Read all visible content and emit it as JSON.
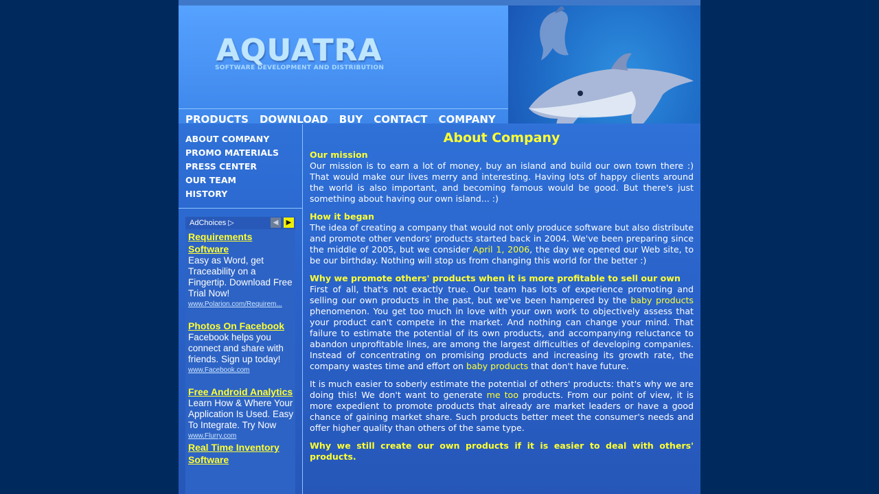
{
  "brand": {
    "logo": "AQUATRA",
    "tagline": "SOFTWARE DEVELOPMENT AND DISTRIBUTION"
  },
  "topnav": [
    "PRODUCTS",
    "DOWNLOAD",
    "BUY",
    "CONTACT",
    "COMPANY"
  ],
  "sidenav": [
    "ABOUT COMPANY",
    "PROMO MATERIALS",
    "PRESS CENTER",
    "OUR TEAM",
    "HISTORY"
  ],
  "ads": {
    "adchoices": "AdChoices",
    "items": [
      {
        "title": "Requirements Software",
        "text": "Easy as Word, get Traceability on a Fingertip. Download Free Trial Now!",
        "url": "www.Polarion.com/Requirem..."
      },
      {
        "title": "Photos On Facebook",
        "text": "Facebook helps you connect and share with friends. Sign up today!",
        "url": "www.Facebook.com"
      },
      {
        "title": "Free Android Analytics",
        "text": "Learn How & Where Your Application Is Used. Easy To Integrate. Try Now",
        "url": "www.Flurry.com"
      },
      {
        "title": "Real Time Inventory Software",
        "text": "",
        "url": ""
      }
    ]
  },
  "content": {
    "title": "About Company",
    "mission_head": "Our mission",
    "mission_text": "Our mission is to earn a lot of money, buy an island and build our own town there :) That would make our lives merry and interesting. Having lots of happy clients around the world is also important, and becoming famous would be good. But there's just something about having our own island... :)",
    "began_head": "How it began",
    "began_1": "The idea of creating a company that would not only produce software but also distribute and promote other vendors' products started back in 2004. We've been preparing since the middle of 2005, but we consider ",
    "began_hl": "April 1, 2006",
    "began_2": ", the day we opened our Web site, to be our birthday. Nothing will stop us from changing this world for the better :)",
    "why_head": "Why we promote others' products when it is more profitable to sell our own",
    "why_1": "First of all, that's not exactly true. Our team has lots of experience promoting and selling our own products in the past, but we've been hampered by the ",
    "why_hl1": "baby products",
    "why_2": " phenomenon. You get too much in love with your own work to objectively assess that your product can't compete in the market. And nothing can change your mind. That failure to estimate the potential of its own products, and accompanying reluctance to abandon unprofitable lines, are among the largest difficulties of developing companies. Instead of concentrating on promising products and increasing its growth rate, the company wastes time and effort on ",
    "why_hl2": "baby products",
    "why_3": " that don't have future.",
    "easier_1": "It is much easier to soberly estimate the potential of others' products: that's why we are doing this! We don't want to generate ",
    "easier_hl": "me too",
    "easier_2": " products. From our point of view, it is more expedient to promote products that already are market leaders or have a good chance of gaining market share. Such products better meet the consumer's needs and offer higher quality than others of the same type.",
    "still_head": "Why we still create our own products if it is easier to deal with others' products."
  },
  "colors": {
    "background": "#002a5e",
    "page": "#2e6fd6",
    "highlight": "#ffff33"
  }
}
